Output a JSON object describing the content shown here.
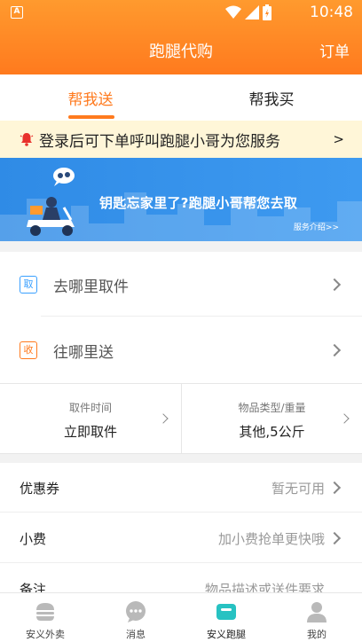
{
  "status": {
    "time": "10:48",
    "notify_glyph": "A"
  },
  "nav": {
    "title": "跑腿代购",
    "right_label": "订单"
  },
  "tabs": [
    {
      "label": "帮我送",
      "active": true
    },
    {
      "label": "帮我买",
      "active": false
    }
  ],
  "notice": {
    "text": "登录后可下单呼叫跑腿小哥为您服务",
    "arrow": ">"
  },
  "banner": {
    "headline": "钥匙忘家里了?跑腿小哥帮您去取",
    "link": "服务介绍>>"
  },
  "address": {
    "pickup": {
      "tag": "取",
      "label": "去哪里取件"
    },
    "delivery": {
      "tag": "收",
      "label": "往哪里送"
    }
  },
  "options": {
    "pickup_time": {
      "label": "取件时间",
      "value": "立即取件"
    },
    "item_type": {
      "label": "物品类型/重量",
      "value": "其他,5公斤"
    }
  },
  "list": [
    {
      "key": "优惠券",
      "value": "暂无可用"
    },
    {
      "key": "小费",
      "value": "加小费抢单更快哦"
    },
    {
      "key": "备注",
      "value": "物品描述或送件要求"
    }
  ],
  "tabbar": [
    {
      "label": "安义外卖",
      "icon": "burger-icon",
      "active": false
    },
    {
      "label": "消息",
      "icon": "chat-icon",
      "active": false
    },
    {
      "label": "安义跑腿",
      "icon": "delivery-box-icon",
      "active": true
    },
    {
      "label": "我的",
      "icon": "user-icon",
      "active": false
    }
  ],
  "colors": {
    "accent": "#ff7a1e",
    "banner": "#3e9af0",
    "active_tab_icon": "#27c2c2",
    "inactive_icon": "#b9b9b9"
  }
}
